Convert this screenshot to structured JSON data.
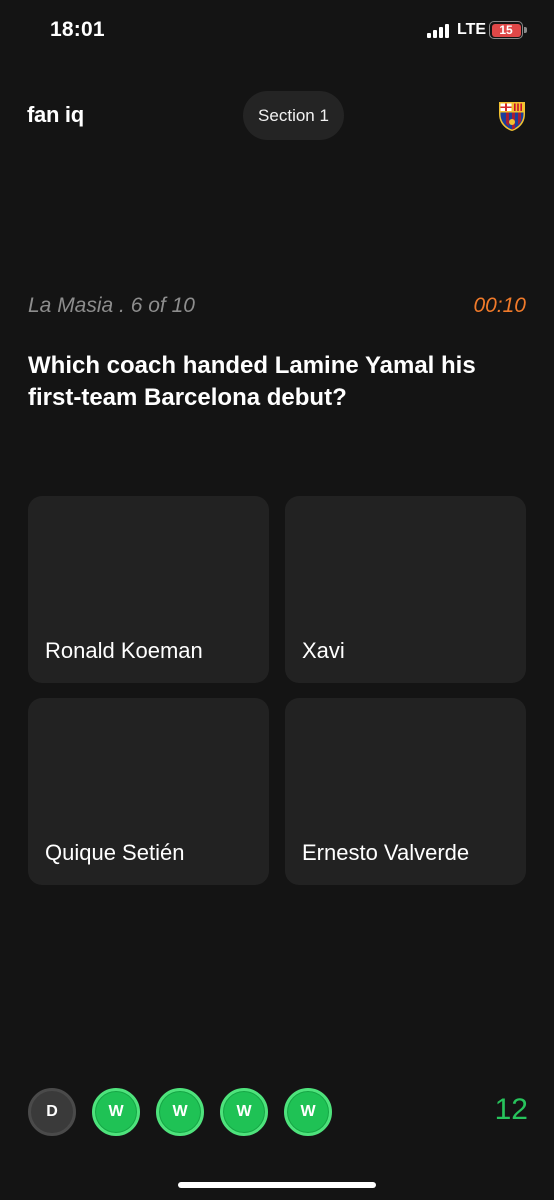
{
  "status_bar": {
    "time": "18:01",
    "network": "LTE",
    "battery_level": "15",
    "battery_color": "#e04848"
  },
  "header": {
    "app_name": "fan iq",
    "section_label": "Section 1",
    "crest_icon": "fc-barcelona-crest-icon"
  },
  "quiz": {
    "category": "La Masia . 6 of 10",
    "timer": "00:10",
    "timer_color": "#f07a2a",
    "question": "Which coach handed Lamine Yamal his first-team Barcelona debut?",
    "answers": [
      {
        "label": "Ronald Koeman"
      },
      {
        "label": "Xavi"
      },
      {
        "label": "Quique Setién"
      },
      {
        "label": "Ernesto Valverde"
      }
    ]
  },
  "results": {
    "items": [
      "D",
      "W",
      "W",
      "W",
      "W"
    ],
    "win_color": "#1fc255",
    "draw_color": "#3a3a3a",
    "score": "12",
    "score_color": "#27c45c"
  }
}
